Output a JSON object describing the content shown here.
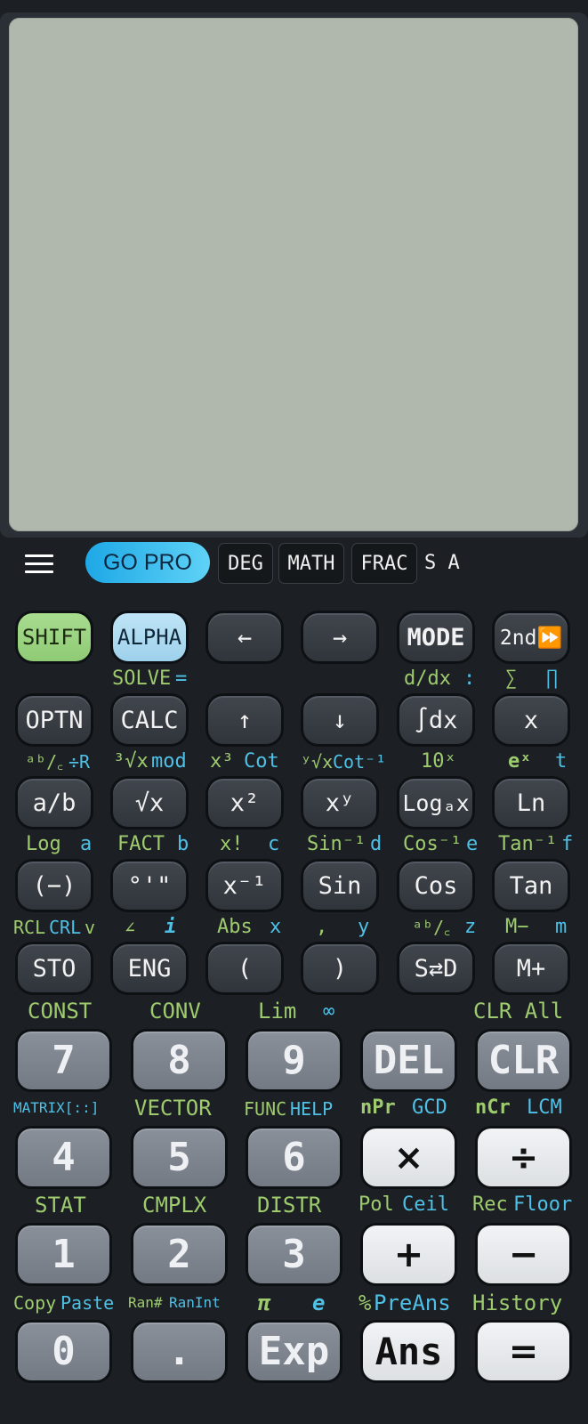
{
  "status": {
    "gopro": "GO PRO",
    "indicators": [
      "DEG",
      "MATH",
      "FRAC"
    ],
    "sa": "S A"
  },
  "keys": {
    "r1": [
      "SHIFT",
      "ALPHA",
      "←",
      "→",
      "MODE",
      "2nd⏩"
    ],
    "r2": [
      "OPTN",
      "CALC",
      "↑",
      "↓",
      "∫dx",
      "x"
    ],
    "r3": [
      "a/b",
      "√x",
      "x²",
      "xʸ",
      "Logₐx",
      "Ln"
    ],
    "r4": [
      "(−)",
      "°'\"",
      "x⁻¹",
      "Sin",
      "Cos",
      "Tan"
    ],
    "r5": [
      "STO",
      "ENG",
      "(",
      ")",
      "S⇄D",
      "M+"
    ],
    "n1": [
      "7",
      "8",
      "9",
      "DEL",
      "CLR"
    ],
    "n2": [
      "4",
      "5",
      "6",
      "×",
      "÷"
    ],
    "n3": [
      "1",
      "2",
      "3",
      "+",
      "−"
    ],
    "n4": [
      "0",
      ".",
      "Exp",
      "Ans",
      "="
    ]
  },
  "labels": {
    "solve": "SOLVE",
    "eq": "=",
    "ddx": "d/dx",
    "colon": ":",
    "sum": "∑",
    "prod": "∏",
    "abc_r": "ᵃᵇ/꜀",
    "divr": "÷R",
    "cbrt": "³√x",
    "mod": "mod",
    "x3": "x³",
    "cot": "Cot",
    "yroot": "ʸ√x",
    "cotinv": "Cot⁻¹",
    "tenx": "10ˣ",
    "ex": "eˣ",
    "t": "t",
    "log": "Log",
    "a": "a",
    "fact": "FACT",
    "b": "b",
    "xfact": "x!",
    "c": "c",
    "sininv": "Sin⁻¹",
    "d": "d",
    "cosinv": "Cos⁻¹",
    "e": "e",
    "taninv": "Tan⁻¹",
    "f": "f",
    "rcl": "RCL",
    "crl": "CRL",
    "v": "v",
    "angle": "∠",
    "i": "i",
    "abs": "Abs",
    "x": "x",
    "comma": ",",
    "y": "y",
    "abc2": "ᵃᵇ/꜀",
    "z": "z",
    "mminus": "M−",
    "m": "m",
    "const": "CONST",
    "conv": "CONV",
    "lim": "Lim",
    "inf": "∞",
    "clrall": "CLR All",
    "matrix": "MATRIX[::]",
    "vector": "VECTOR",
    "func": "FUNC",
    "help": "HELP",
    "npr": "nPr",
    "gcd": "GCD",
    "ncr": "nCr",
    "lcm": "LCM",
    "stat": "STAT",
    "cmplx": "CMPLX",
    "distr": "DISTR",
    "pol": "Pol",
    "ceil": "Ceil",
    "rec": "Rec",
    "floor": "Floor",
    "copy": "Copy",
    "paste": "Paste",
    "ran": "Ran#",
    "ranint": "RanInt",
    "pi": "π",
    "econst": "e",
    "pct": "%",
    "preans": "PreAns",
    "history": "History"
  }
}
